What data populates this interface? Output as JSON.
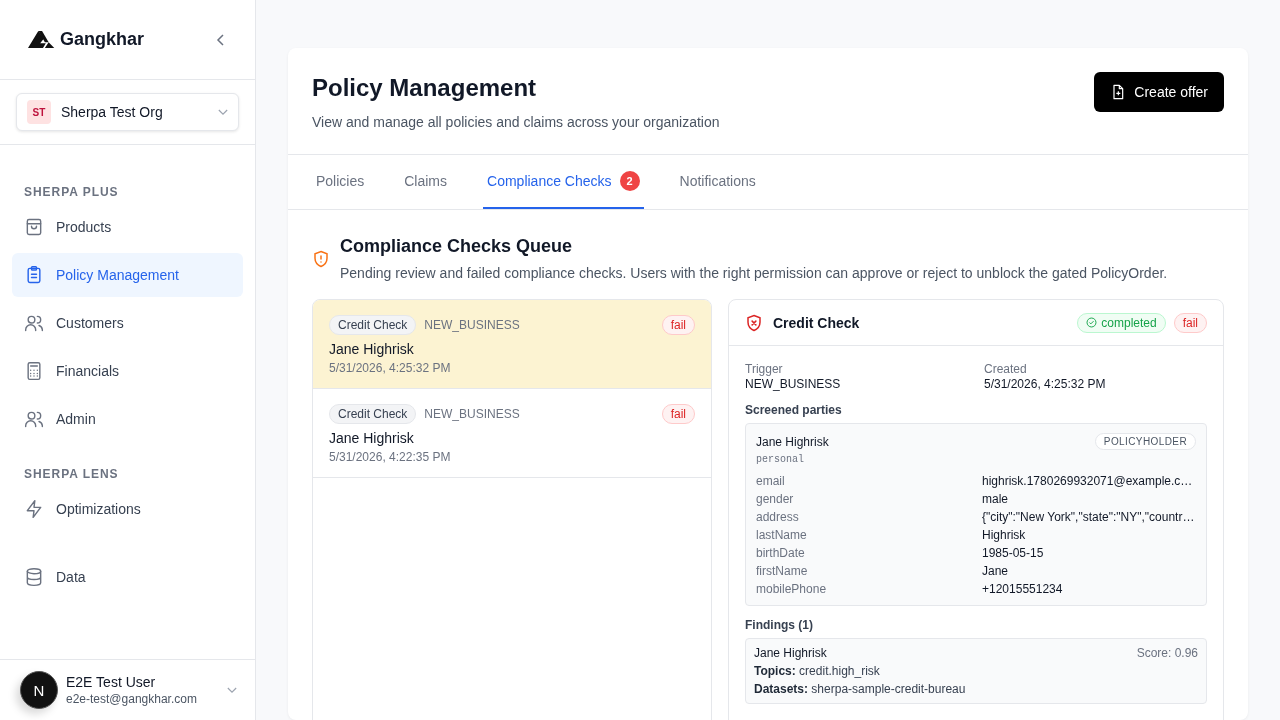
{
  "sidebar": {
    "brand": "Gangkhar",
    "org": {
      "initials": "ST",
      "name": "Sherpa Test Org"
    },
    "sections": [
      {
        "title": "SHERPA PLUS",
        "items": [
          {
            "label": "Products",
            "selected": false
          },
          {
            "label": "Policy Management",
            "selected": true
          },
          {
            "label": "Customers",
            "selected": false
          },
          {
            "label": "Financials",
            "selected": false
          },
          {
            "label": "Admin",
            "selected": false
          }
        ]
      },
      {
        "title": "SHERPA LENS",
        "items": [
          {
            "label": "Optimizations",
            "selected": false
          }
        ]
      },
      {
        "items": [
          {
            "label": "Data",
            "selected": false
          }
        ]
      }
    ],
    "user": {
      "initial": "N",
      "name": "E2E Test User",
      "email": "e2e-test@gangkhar.com"
    }
  },
  "page": {
    "title": "Policy Management",
    "subtitle": "View and manage all policies and claims across your organization",
    "action": "Create offer"
  },
  "tabs": [
    {
      "label": "Policies",
      "selected": false
    },
    {
      "label": "Claims",
      "selected": false
    },
    {
      "label": "Compliance Checks",
      "selected": true,
      "badge": "2"
    },
    {
      "label": "Notifications",
      "selected": false
    }
  ],
  "queue": {
    "title": "Compliance Checks Queue",
    "description": "Pending review and failed compliance checks. Users with the right permission can approve or reject to unblock the gated PolicyOrder.",
    "items": [
      {
        "check": "Credit Check",
        "trigger": "NEW_BUSINESS",
        "status": {
          "label": "fail",
          "kind": "danger"
        },
        "name": "Jane Highrisk",
        "time": "5/31/2026, 4:25:32 PM",
        "selected": true
      },
      {
        "check": "Credit Check",
        "trigger": "NEW_BUSINESS",
        "status": {
          "label": "fail",
          "kind": "danger"
        },
        "name": "Jane Highrisk",
        "time": "5/31/2026, 4:22:35 PM",
        "selected": false
      }
    ]
  },
  "detail": {
    "title": "Credit Check",
    "statuses": [
      {
        "label": "completed",
        "kind": "success"
      },
      {
        "label": "fail",
        "kind": "danger"
      }
    ],
    "fields": [
      {
        "label": "Trigger",
        "value": "NEW_BUSINESS"
      },
      {
        "label": "Created",
        "value": "5/31/2026, 4:25:32 PM"
      }
    ],
    "parties_heading": "Screened parties",
    "parties": [
      {
        "name": "Jane Highrisk",
        "role": "POLICYHOLDER",
        "type": "personal",
        "attributes": [
          {
            "key": "email",
            "value": "highrisk.1780269932071@example.c…"
          },
          {
            "key": "gender",
            "value": "male"
          },
          {
            "key": "address",
            "value": "{\"city\":\"New York\",\"state\":\"NY\",\"countr…"
          },
          {
            "key": "lastName",
            "value": "Highrisk"
          },
          {
            "key": "birthDate",
            "value": "1985-05-15"
          },
          {
            "key": "firstName",
            "value": "Jane"
          },
          {
            "key": "mobilePhone",
            "value": "+12015551234"
          }
        ]
      }
    ],
    "findings_heading": "Findings (1)",
    "findings": [
      {
        "name": "Jane Highrisk",
        "score": "Score: 0.96",
        "lines": [
          "**Topics:** credit.high_risk",
          "**Datasets:** sherpa-sample-credit-bureau"
        ]
      }
    ]
  }
}
